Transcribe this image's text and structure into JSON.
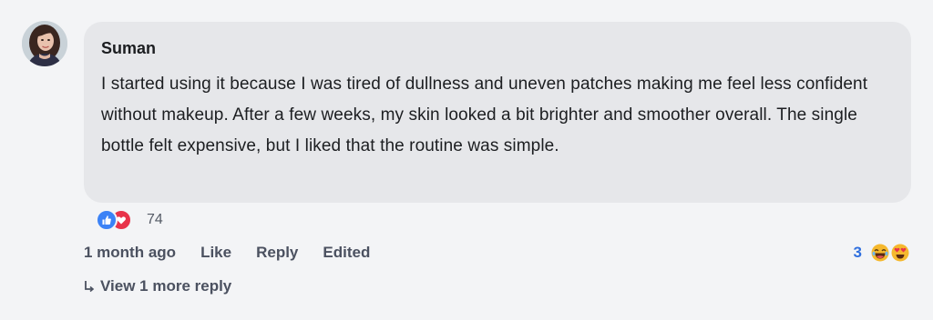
{
  "comment": {
    "author": "Suman",
    "text": "I started using it because I was tired of dullness and uneven patches making me feel less confident without makeup. After a few weeks, my skin looked a bit brighter and smoother overall. The single bottle felt expensive, but I liked that the routine was simple.",
    "reaction_count": "74",
    "reaction_icons": [
      "like-icon",
      "love-icon"
    ],
    "timestamp": "1 month ago",
    "actions": {
      "like": "Like",
      "reply": "Reply",
      "edited": "Edited"
    },
    "side_reactions": {
      "count": "3",
      "icons": [
        "laughing-emoji-icon",
        "heart-eyes-emoji-icon"
      ]
    },
    "view_replies": "View 1 more reply"
  },
  "colors": {
    "background": "#f3f4f6",
    "bubble": "#e6e7ea",
    "like_blue": "#3b82f6",
    "love_red": "#e8334a",
    "count_blue": "#2f6fde",
    "meta_gray": "#4b5160"
  }
}
